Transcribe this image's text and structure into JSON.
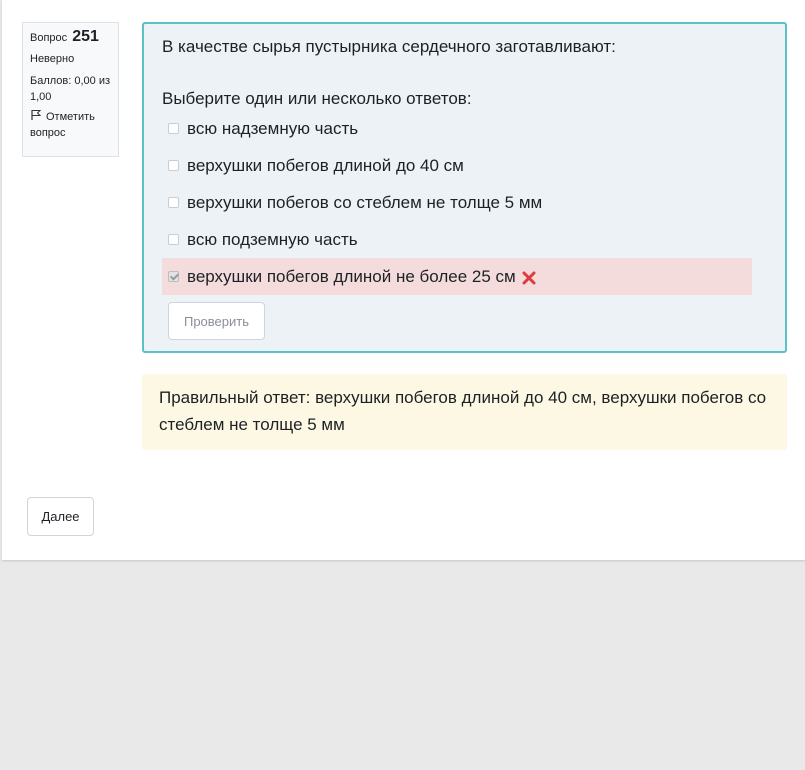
{
  "question_info": {
    "label": "Вопрос",
    "number": "251",
    "state": "Неверно",
    "grade": "Баллов: 0,00 из 1,00",
    "flag_label": "Отметить вопрос"
  },
  "question": {
    "text": "В качестве сырья пустырника сердечного заготавливают:",
    "prompt": "Выберите один или несколько ответов:",
    "answers": [
      {
        "label": "всю надземную часть",
        "checked": false
      },
      {
        "label": "верхушки побегов длиной до 40 см",
        "checked": false
      },
      {
        "label": "верхушки побегов со стеблем не толще 5 мм",
        "checked": false
      },
      {
        "label": "всю подземную часть",
        "checked": false
      },
      {
        "label": "верхушки побегов длиной не более 25 см",
        "checked": true,
        "status": "incorrect"
      }
    ],
    "check_button": "Проверить"
  },
  "feedback": {
    "right_answer": "Правильный ответ: верхушки побегов длиной до 40 см, верхушки побегов со стеблем не толще 5 мм"
  },
  "navigation": {
    "next_button": "Далее"
  },
  "colors": {
    "content_border": "#5bc0c7",
    "incorrect_bg": "#f4dcdc",
    "feedback_bg": "#fcf8e3",
    "wrong_icon": "#e0393e"
  }
}
